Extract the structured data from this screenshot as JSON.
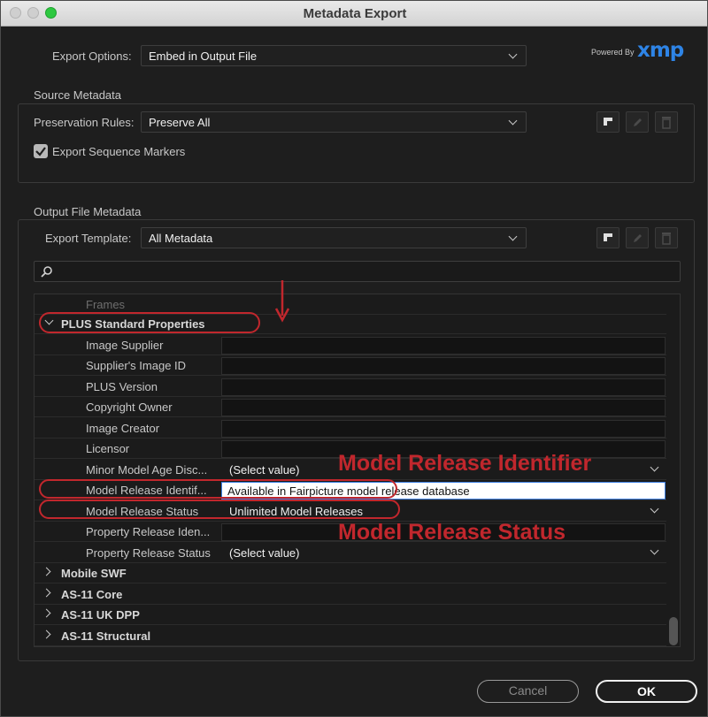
{
  "window": {
    "title": "Metadata Export"
  },
  "export_options": {
    "label": "Export Options:",
    "value": "Embed in Output File"
  },
  "branding": {
    "powered_by": "Powered By",
    "logo": "xmp"
  },
  "source_metadata": {
    "group_label": "Source Metadata",
    "preservation_label": "Preservation Rules:",
    "preservation_value": "Preserve All",
    "export_markers_label": "Export Sequence Markers",
    "export_markers_checked": true
  },
  "output_metadata": {
    "group_label": "Output File Metadata",
    "template_label": "Export Template:",
    "template_value": "All Metadata"
  },
  "search": {
    "placeholder": ""
  },
  "tree": {
    "frames": "Frames",
    "plus_group": "PLUS Standard Properties",
    "rows": [
      {
        "label": "Image Supplier",
        "value": ""
      },
      {
        "label": "Supplier's Image ID",
        "value": ""
      },
      {
        "label": "PLUS Version",
        "value": ""
      },
      {
        "label": "Copyright Owner",
        "value": ""
      },
      {
        "label": "Image Creator",
        "value": ""
      },
      {
        "label": "Licensor",
        "value": ""
      },
      {
        "label": "Minor Model Age Disc...",
        "value": "(Select value)"
      },
      {
        "label": "Model Release Identif...",
        "value": "Available in Fairpicture model release database"
      },
      {
        "label": "Model Release Status",
        "value": "Unlimited Model Releases"
      },
      {
        "label": "Property Release Iden...",
        "value": ""
      },
      {
        "label": "Property Release Status",
        "value": "(Select value)"
      }
    ],
    "collapsed_groups": [
      "Mobile SWF",
      "AS-11 Core",
      "AS-11 UK DPP",
      "AS-11 Structural"
    ]
  },
  "annotations": {
    "identifier_label": "Model Release Identifier",
    "status_label": "Model Release Status",
    "color": "#c1272d"
  },
  "buttons": {
    "cancel": "Cancel",
    "ok": "OK"
  },
  "colors": {
    "accent_blue": "#2e84e6",
    "background": "#1e1e1e"
  },
  "icons": [
    "new-preset-icon",
    "edit-pencil-icon",
    "trash-icon",
    "search-icon",
    "checkmark-icon",
    "chevron-down-icon",
    "disclosure-triangle-icon",
    "red-arrow-icon"
  ]
}
